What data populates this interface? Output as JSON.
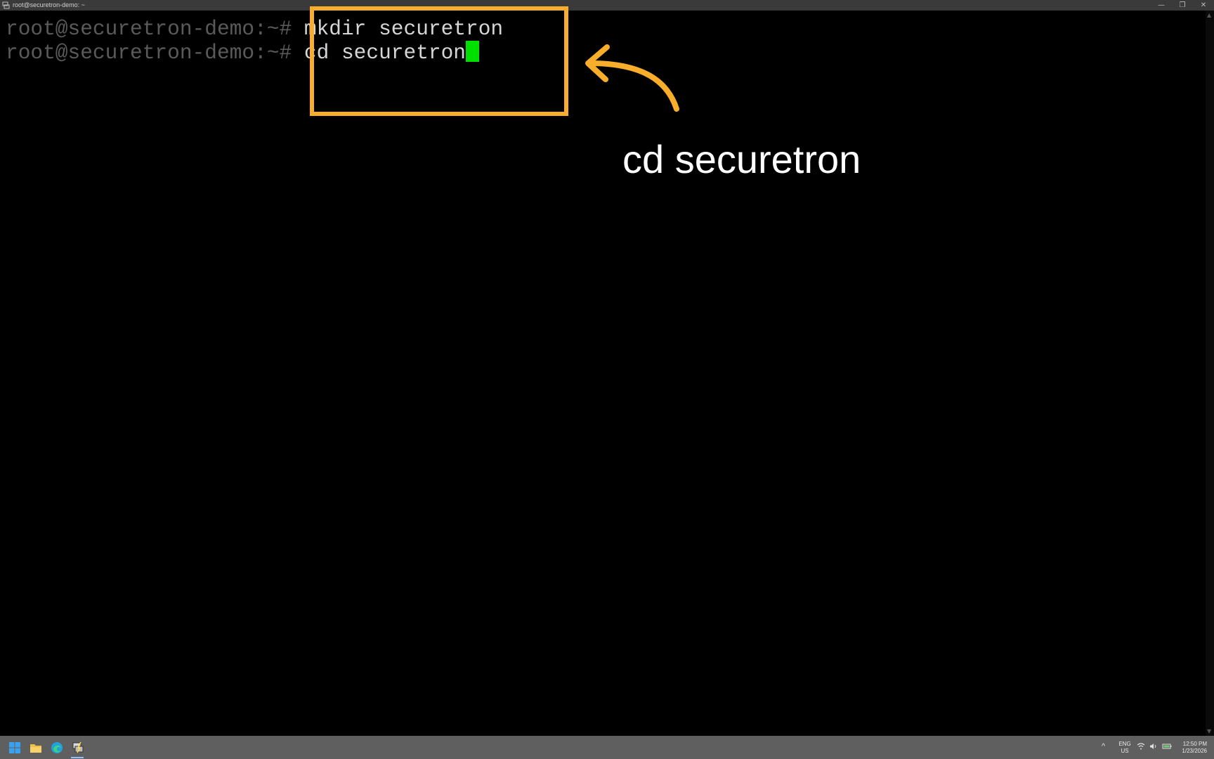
{
  "window": {
    "title": "root@securetron-demo: ~",
    "controls": {
      "minimize": "—",
      "restore": "❐",
      "close": "✕"
    }
  },
  "terminal": {
    "lines": [
      {
        "prompt": "root@securetron-demo:~#",
        "command": " mkdir securetron"
      },
      {
        "prompt": "root@securetron-demo:~#",
        "command": " cd securetron"
      }
    ],
    "cursor_color": "#00e000"
  },
  "annotation": {
    "callout_text": "cd securetron",
    "accent_color": "#f8ad2b"
  },
  "taskbar": {
    "apps": [
      {
        "name": "start-icon"
      },
      {
        "name": "file-explorer-icon"
      },
      {
        "name": "edge-browser-icon"
      },
      {
        "name": "putty-terminal-icon"
      }
    ],
    "tray": {
      "chevron": "^",
      "language_top": "ENG",
      "language_bottom": "US",
      "time": "12:50 PM",
      "date": "1/23/2026"
    }
  }
}
